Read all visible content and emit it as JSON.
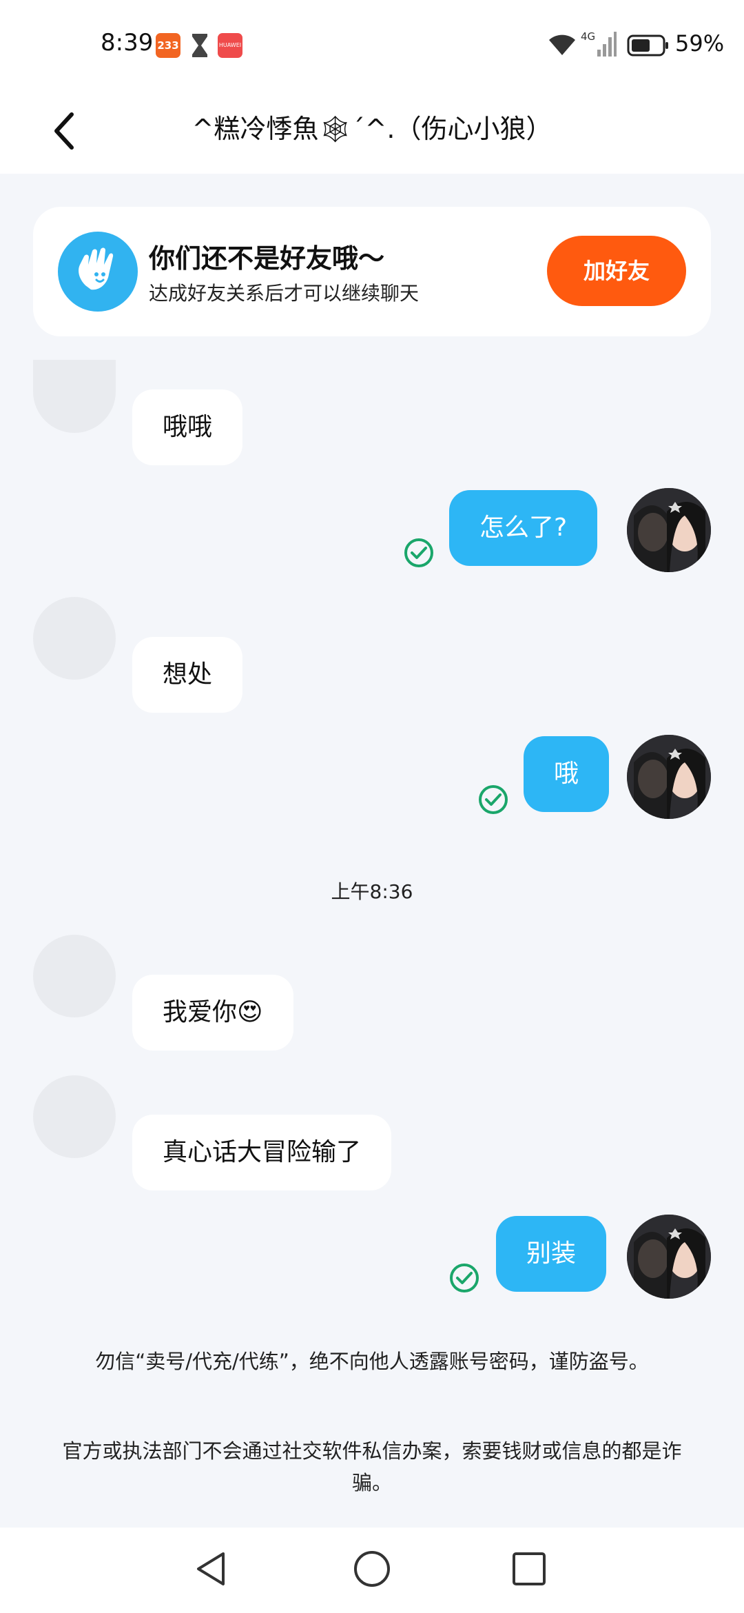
{
  "status_bar": {
    "time": "8:39",
    "app_badge_233": "233",
    "huawei_badge": "HUAWEI",
    "network": "4G",
    "battery": "59%"
  },
  "header": {
    "back_icon": "chevron-left-icon",
    "title": "^糕冷悸魚🕸´^.（伤心小狼）"
  },
  "banner": {
    "title": "你们还不是好友哦～",
    "subtitle": "达成好友关系后才可以继续聊天",
    "button_label": "加好友",
    "icon": "wave-hand-icon",
    "accent": "#ff5a0f"
  },
  "messages": [
    {
      "side": "left",
      "text": "哦哦"
    },
    {
      "side": "right",
      "text": "怎么了?",
      "read": true
    },
    {
      "side": "left",
      "text": "想处"
    },
    {
      "side": "right",
      "text": "哦",
      "read": true
    },
    {
      "side": "left",
      "text": "我爱你😍"
    },
    {
      "side": "left",
      "text": "真心话大冒险输了"
    },
    {
      "side": "right",
      "text": "别装",
      "read": true
    }
  ],
  "timestamp": "上午8:36",
  "notices": [
    "勿信“卖号/代充/代练”，绝不向他人透露账号密码，谨防盗号。",
    "官方或执法部门不会通过社交软件私信办案，索要钱财或信息的都是诈骗。"
  ],
  "colors": {
    "bubble_right": "#2db6f5",
    "background": "#f4f6fa",
    "check": "#1aa66a"
  },
  "nav": {
    "back": "triangle-back-icon",
    "home": "circle-home-icon",
    "recents": "square-recents-icon"
  }
}
